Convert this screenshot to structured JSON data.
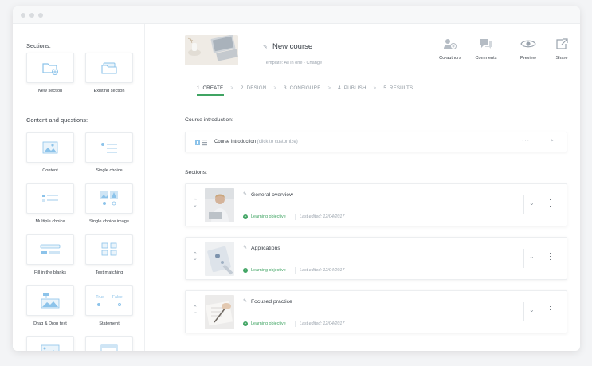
{
  "sidebar": {
    "sections_heading": "Sections:",
    "section_items": [
      {
        "label": "New section",
        "icon": "new-section-icon"
      },
      {
        "label": "Existing section",
        "icon": "existing-section-icon"
      }
    ],
    "content_heading": "Content and questions:",
    "content_items": [
      {
        "label": "Content",
        "icon": "content-icon"
      },
      {
        "label": "Single choice",
        "icon": "single-choice-icon"
      },
      {
        "label": "Multiple choice",
        "icon": "multiple-choice-icon"
      },
      {
        "label": "Single choice image",
        "icon": "single-choice-image-icon"
      },
      {
        "label": "Fill in the blanks",
        "icon": "fill-blanks-icon"
      },
      {
        "label": "Text matching",
        "icon": "text-matching-icon"
      },
      {
        "label": "Drag & Drop text",
        "icon": "drag-drop-icon"
      },
      {
        "label": "Statement",
        "icon": "statement-icon",
        "true_label": "True",
        "false_label": "False"
      }
    ]
  },
  "header": {
    "course_title": "New course",
    "template_prefix": "Template: All in one - ",
    "template_link": "Change",
    "actions": [
      {
        "label": "Co-authors",
        "icon": "co-authors-icon"
      },
      {
        "label": "Comments",
        "icon": "comments-icon"
      },
      {
        "label": "Preview",
        "icon": "eye-icon"
      },
      {
        "label": "Share",
        "icon": "share-icon"
      }
    ]
  },
  "steps": [
    {
      "label": "1. CREATE",
      "active": true
    },
    {
      "label": "2. DESIGN",
      "active": false
    },
    {
      "label": "3. CONFIGURE",
      "active": false
    },
    {
      "label": "4. PUBLISH",
      "active": false
    },
    {
      "label": "5. RESULTS",
      "active": false
    }
  ],
  "intro": {
    "heading": "Course introduction:",
    "title": "Course introduction",
    "hint": "(click to customize)"
  },
  "sections": {
    "heading": "Sections:",
    "items": [
      {
        "title": "General overview",
        "objective": "Learning objective",
        "edited": "Last edited: 12/04/2017"
      },
      {
        "title": "Applications",
        "objective": "Learning objective",
        "edited": "Last edited: 12/04/2017"
      },
      {
        "title": "Focused practice",
        "objective": "Learning objective",
        "edited": "Last edited: 12/04/2017"
      }
    ]
  },
  "colors": {
    "accent_green": "#40a463",
    "icon_blue": "#8cc3ea"
  }
}
